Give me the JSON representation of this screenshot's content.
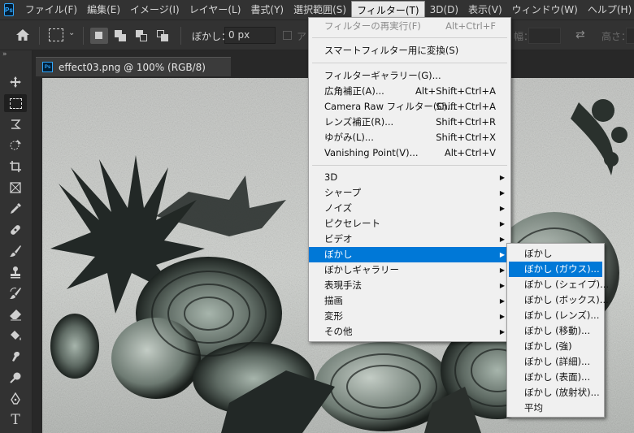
{
  "app": {
    "logo_text": "Ps"
  },
  "menubar": {
    "items": [
      {
        "label": "ファイル(F)"
      },
      {
        "label": "編集(E)"
      },
      {
        "label": "イメージ(I)"
      },
      {
        "label": "レイヤー(L)"
      },
      {
        "label": "書式(Y)"
      },
      {
        "label": "選択範囲(S)"
      },
      {
        "label": "フィルター(T)",
        "active": true
      },
      {
        "label": "3D(D)"
      },
      {
        "label": "表示(V)"
      },
      {
        "label": "ウィンドウ(W)"
      },
      {
        "label": "ヘルプ(H)"
      }
    ]
  },
  "options": {
    "feather_label": "ぼかし：",
    "feather_value": "0 px",
    "antialias_label": "ア",
    "width_label": "幅：",
    "height_label": "高さ："
  },
  "document": {
    "tab_title": "effect03.png @ 100% (RGB/8)",
    "tab_icon_text": "Ps"
  },
  "filter_menu": {
    "items": [
      {
        "label": "フィルターの再実行(F)",
        "shortcut": "Alt+Ctrl+F",
        "disabled": true
      },
      {
        "label": "スマートフィルター用に変換(S)",
        "shortcut": ""
      },
      {
        "label": "フィルターギャラリー(G)...",
        "shortcut": ""
      },
      {
        "label": "広角補正(A)...",
        "shortcut": "Alt+Shift+Ctrl+A"
      },
      {
        "label": "Camera Raw フィルター(C)...",
        "shortcut": "Shift+Ctrl+A"
      },
      {
        "label": "レンズ補正(R)...",
        "shortcut": "Shift+Ctrl+R"
      },
      {
        "label": "ゆがみ(L)...",
        "shortcut": "Shift+Ctrl+X"
      },
      {
        "label": "Vanishing Point(V)...",
        "shortcut": "Alt+Ctrl+V"
      },
      {
        "label": "3D",
        "submenu": true
      },
      {
        "label": "シャープ",
        "submenu": true
      },
      {
        "label": "ノイズ",
        "submenu": true
      },
      {
        "label": "ピクセレート",
        "submenu": true
      },
      {
        "label": "ビデオ",
        "submenu": true
      },
      {
        "label": "ぼかし",
        "submenu": true,
        "highlight": true
      },
      {
        "label": "ぼかしギャラリー",
        "submenu": true
      },
      {
        "label": "表現手法",
        "submenu": true
      },
      {
        "label": "描画",
        "submenu": true
      },
      {
        "label": "変形",
        "submenu": true
      },
      {
        "label": "その他",
        "submenu": true
      }
    ]
  },
  "blur_submenu": {
    "items": [
      {
        "label": "ぼかし"
      },
      {
        "label": "ぼかし (ガウス)...",
        "highlight": true
      },
      {
        "label": "ぼかし (シェイプ)..."
      },
      {
        "label": "ぼかし (ボックス)..."
      },
      {
        "label": "ぼかし (レンズ)..."
      },
      {
        "label": "ぼかし (移動)..."
      },
      {
        "label": "ぼかし (強)"
      },
      {
        "label": "ぼかし (詳細)..."
      },
      {
        "label": "ぼかし (表面)..."
      },
      {
        "label": "ぼかし (放射状)..."
      },
      {
        "label": "平均"
      }
    ]
  },
  "colors": {
    "highlight": "#0078d7",
    "menu_bg": "#f0f0f0",
    "chrome_bg": "#323232",
    "ps_blue": "#31a8ff"
  },
  "toolbar": {
    "tools": [
      "move-tool-icon",
      "marquee-tool-icon",
      "lasso-tool-icon",
      "quick-select-tool-icon",
      "crop-tool-icon",
      "frame-tool-icon",
      "eyedropper-tool-icon",
      "healing-brush-icon",
      "brush-tool-icon",
      "clone-stamp-icon",
      "history-brush-icon",
      "eraser-tool-icon",
      "paint-bucket-icon",
      "smudge-tool-icon",
      "dodge-tool-icon",
      "pen-tool-icon",
      "type-tool-icon"
    ]
  }
}
